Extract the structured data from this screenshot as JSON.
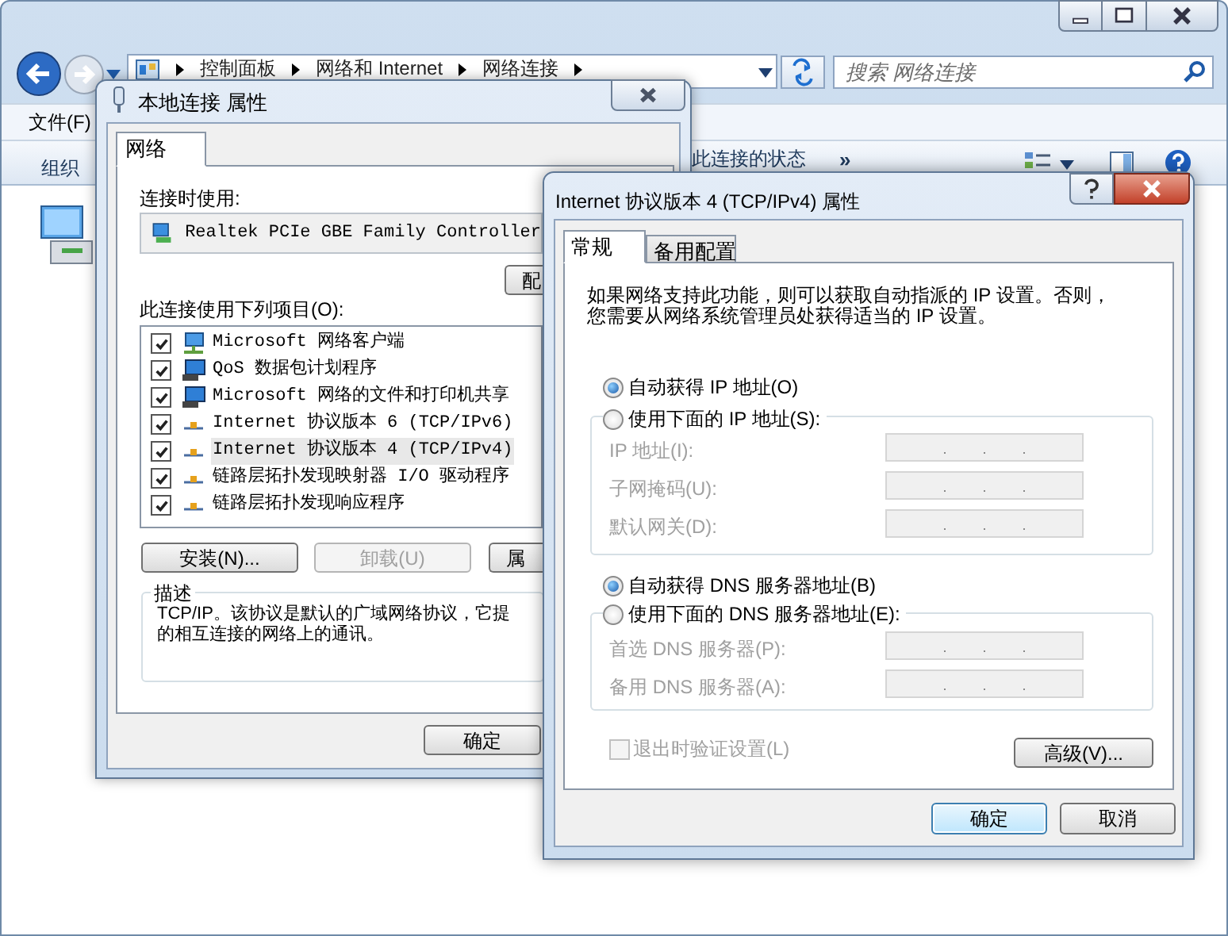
{
  "explorer": {
    "breadcrumb": [
      "控制面板",
      "网络和 Internet",
      "网络连接"
    ],
    "search": {
      "placeholder": "搜索 网络连接"
    },
    "menu": [
      "文件(F)"
    ],
    "toolbar": {
      "organize": "组织",
      "status_link": "此连接的状态",
      "more": "»"
    }
  },
  "local_connection_dialog": {
    "title": "本地连接 属性",
    "tabs": [
      {
        "label": "网络",
        "selected": true
      }
    ],
    "connect_using_label": "连接时使用:",
    "adapter": "Realtek PCIe GBE Family Controller",
    "configure_button": "配",
    "items_label": "此连接使用下列项目(O):",
    "items": [
      {
        "kind": "client",
        "label": "Microsoft 网络客户端",
        "checked": true,
        "selected": false
      },
      {
        "kind": "service",
        "label": "QoS 数据包计划程序",
        "checked": true,
        "selected": false
      },
      {
        "kind": "service",
        "label": "Microsoft 网络的文件和打印机共享",
        "checked": true,
        "selected": false
      },
      {
        "kind": "protocol",
        "label": "Internet 协议版本 6 (TCP/IPv6)",
        "checked": true,
        "selected": false
      },
      {
        "kind": "protocol",
        "label": "Internet 协议版本 4 (TCP/IPv4)",
        "checked": true,
        "selected": true
      },
      {
        "kind": "protocol",
        "label": "链路层拓扑发现映射器 I/O 驱动程序",
        "checked": true,
        "selected": false
      },
      {
        "kind": "protocol",
        "label": "链路层拓扑发现响应程序",
        "checked": true,
        "selected": false
      }
    ],
    "buttons": [
      {
        "label": "安装(N)...",
        "disabled": false
      },
      {
        "label": "卸载(U)",
        "disabled": true
      },
      {
        "label": "属",
        "disabled": false
      }
    ],
    "description_title": "描述",
    "description_lines": [
      "TCP/IP。该协议是默认的广域网络协议，它提",
      "的相互连接的网络上的通讯。"
    ],
    "ok_button": "确定"
  },
  "ipv4_dialog": {
    "title": "Internet 协议版本 4 (TCP/IPv4) 属性",
    "tabs": [
      {
        "label": "常规",
        "selected": true
      },
      {
        "label": "备用配置",
        "selected": false
      }
    ],
    "intro_lines": [
      "如果网络支持此功能，则可以获取自动指派的 IP 设置。否则，",
      "您需要从网络系统管理员处获得适当的 IP 设置。"
    ],
    "ip_auto": {
      "label": "自动获得 IP 地址(O)",
      "selected": true
    },
    "ip_manual": {
      "label": "使用下面的 IP 地址(S):",
      "selected": false
    },
    "ip_fields": [
      {
        "label": "IP 地址(I):",
        "disabled": true
      },
      {
        "label": "子网掩码(U):",
        "disabled": true
      },
      {
        "label": "默认网关(D):",
        "disabled": true
      }
    ],
    "dns_auto": {
      "label": "自动获得 DNS 服务器地址(B)",
      "selected": true
    },
    "dns_manual": {
      "label": "使用下面的 DNS 服务器地址(E):",
      "selected": false
    },
    "dns_fields": [
      {
        "label": "首选 DNS 服务器(P):",
        "disabled": true
      },
      {
        "label": "备用 DNS 服务器(A):",
        "disabled": true
      }
    ],
    "validate": {
      "label": "退出时验证设置(L)",
      "checked": false,
      "disabled": true
    },
    "advanced_button": "高级(V)...",
    "ok_button": "确定",
    "cancel_button": "取消"
  }
}
